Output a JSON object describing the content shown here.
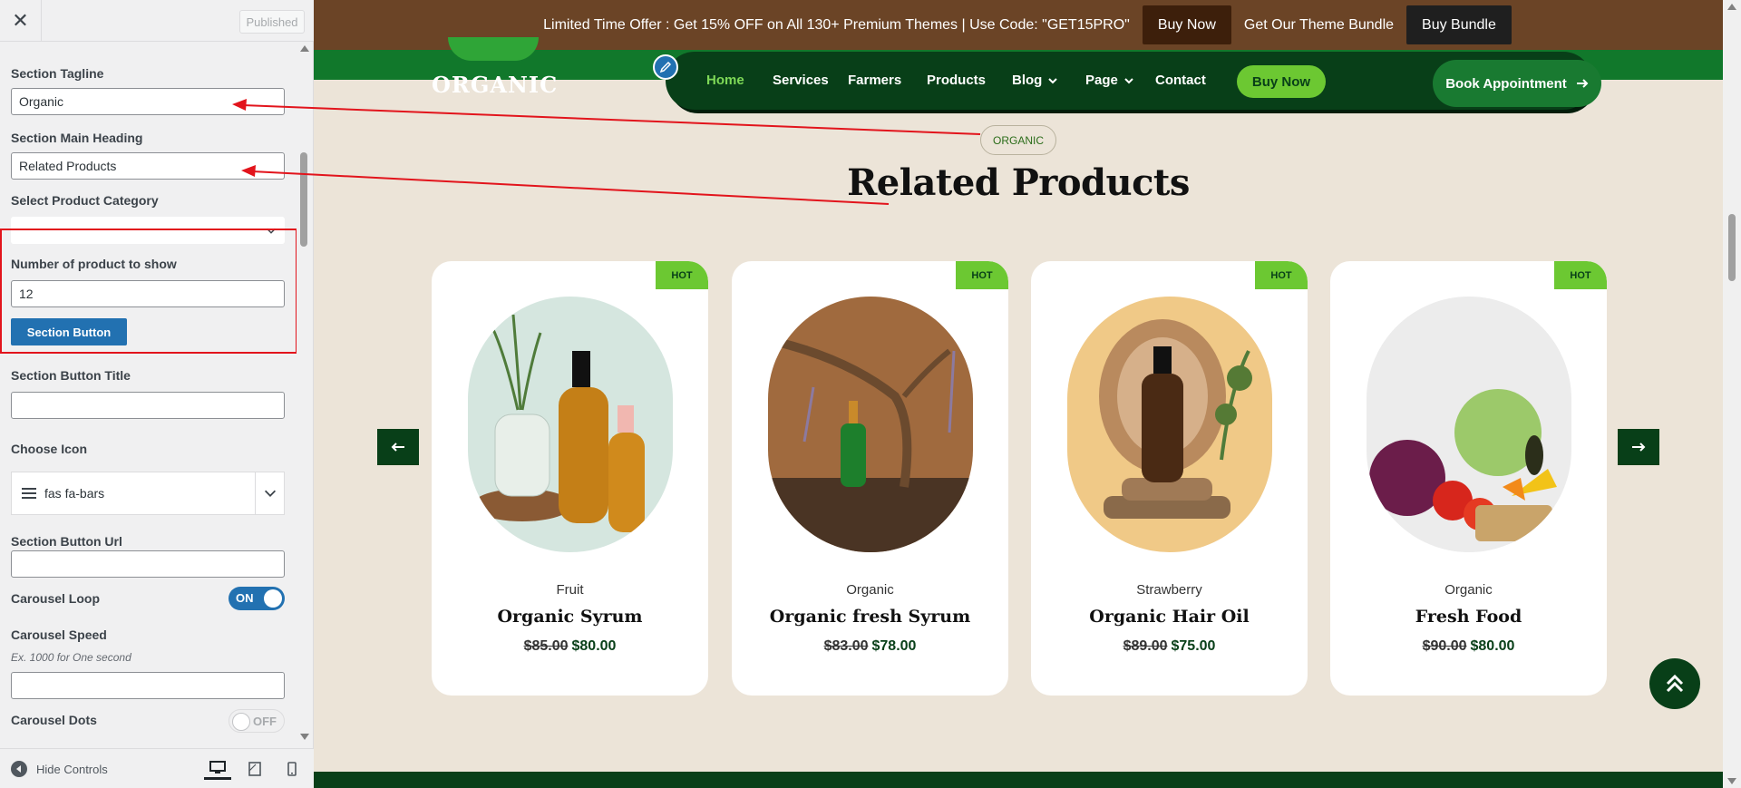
{
  "customizer": {
    "published_label": "Published",
    "fields": {
      "section_tagline": {
        "label": "Section Tagline",
        "value": "Organic"
      },
      "section_main_heading": {
        "label": "Section Main Heading",
        "value": "Related Products"
      },
      "select_product_category": {
        "label": "Select Product Category",
        "value": ""
      },
      "number_of_products": {
        "label": "Number of product to show",
        "value": "12"
      },
      "section_button_heading": "Section Button",
      "section_button_title": {
        "label": "Section Button Title",
        "value": ""
      },
      "choose_icon": {
        "label": "Choose Icon",
        "value": "fas fa-bars"
      },
      "section_button_url": {
        "label": "Section Button Url",
        "value": ""
      },
      "carousel_loop": {
        "label": "Carousel Loop",
        "state": "ON"
      },
      "carousel_speed": {
        "label": "Carousel Speed",
        "hint": "Ex. 1000 for One second",
        "value": ""
      },
      "carousel_dots": {
        "label": "Carousel Dots",
        "state": "OFF"
      }
    },
    "footer": {
      "hide_controls": "Hide Controls"
    }
  },
  "preview": {
    "promo": {
      "text": "Limited Time Offer : Get 15% OFF on All 130+ Premium Themes | Use Code: \"GET15PRO\"",
      "buy_now": "Buy Now",
      "bundle_text": "Get Our Theme Bundle",
      "buy_bundle": "Buy Bundle"
    },
    "logo_text": "ORGANIC",
    "nav": {
      "items": [
        "Home",
        "Services",
        "Farmers",
        "Products",
        "Blog",
        "Page",
        "Contact"
      ],
      "buy_now": "Buy Now",
      "book_appointment": "Book Appointment"
    },
    "section": {
      "tagline": "Organic",
      "tagline_display": "ORGANIC",
      "heading": "Related Products"
    },
    "products": [
      {
        "badge": "HOT",
        "category": "Fruit",
        "name": "Organic Syrum",
        "old_price": "$85.00",
        "price": "$80.00"
      },
      {
        "badge": "HOT",
        "category": "Organic",
        "name": "Organic fresh Syrum",
        "old_price": "$83.00",
        "price": "$78.00"
      },
      {
        "badge": "HOT",
        "category": "Strawberry",
        "name": "Organic Hair Oil",
        "old_price": "$89.00",
        "price": "$75.00"
      },
      {
        "badge": "HOT",
        "category": "Organic",
        "name": "Fresh Food",
        "old_price": "$90.00",
        "price": "$80.00"
      }
    ]
  },
  "colors": {
    "promo_bg": "#6b4426",
    "nav_bg": "#083f18",
    "accent_green": "#6cc832",
    "wp_blue": "#2271b1",
    "annotation_red": "#e2141c",
    "page_bg": "#ece4d8"
  },
  "icons": [
    "close-icon",
    "chevron-down-icon",
    "bars-icon",
    "pencil-icon",
    "arrow-right-icon",
    "arrow-left-icon",
    "double-chevron-up-icon",
    "desktop-icon",
    "tablet-icon",
    "mobile-icon",
    "hide-controls-icon"
  ]
}
